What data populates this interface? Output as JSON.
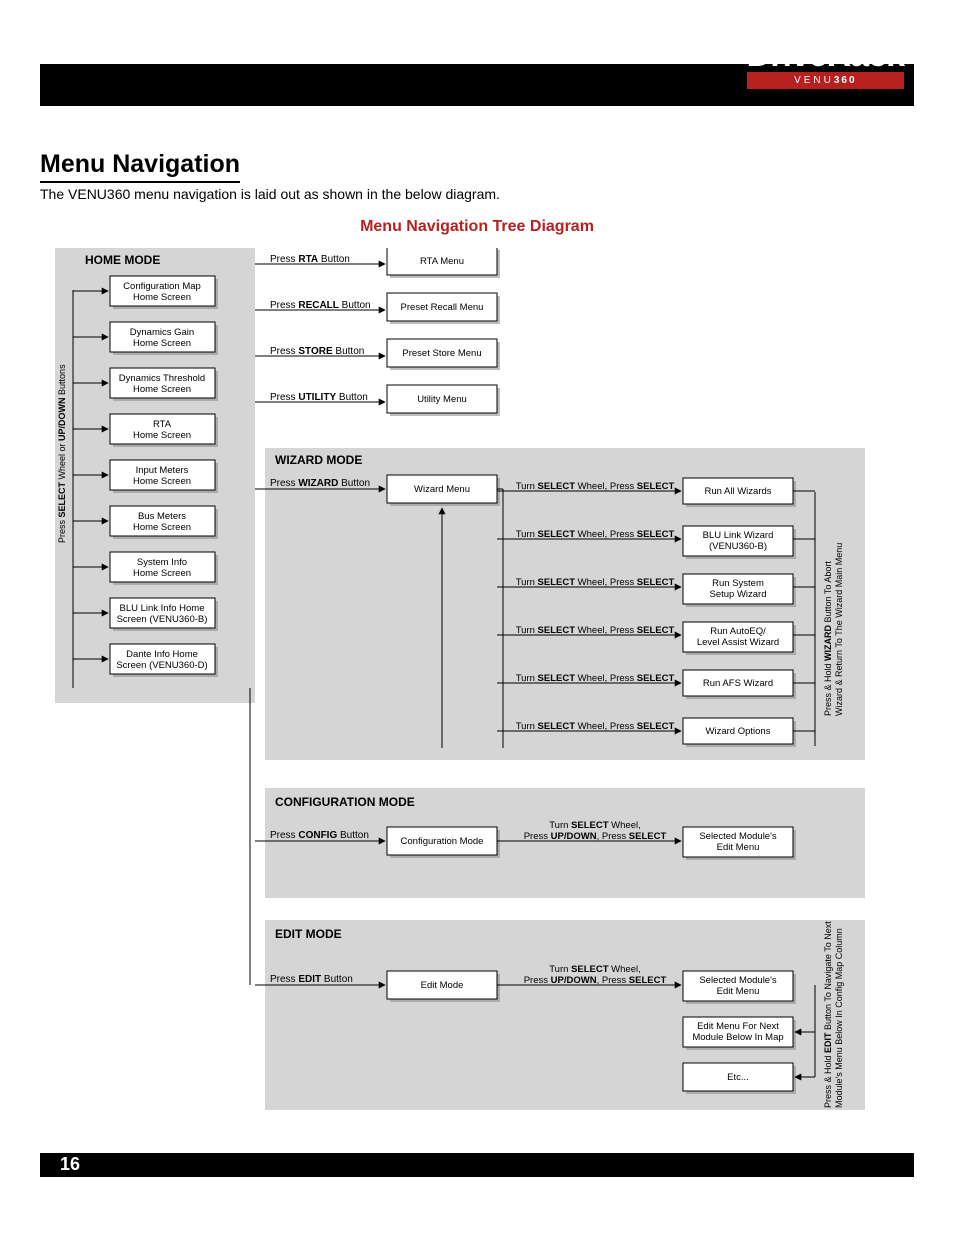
{
  "brand": {
    "name": "DriveRack",
    "sub_pre": "VENU",
    "sub_bold": "360",
    "reg": "®"
  },
  "page": {
    "num": "16"
  },
  "section": {
    "title": "Menu Navigation",
    "intro": "The VENU360 menu navigation is laid out as shown in the below diagram.",
    "tree_title": "Menu Navigation Tree Diagram"
  },
  "home": {
    "title": "HOME MODE",
    "side_label_a": "Press ",
    "side_label_b": "SELECT",
    "side_label_c": " Wheel or ",
    "side_label_d": "UP/DOWN",
    "side_label_e": " Buttons",
    "screens": [
      "Configuration Map\nHome Screen",
      "Dynamics Gain\nHome Screen",
      "Dynamics Threshold\nHome Screen",
      "RTA\nHome Screen",
      "Input Meters\nHome Screen",
      "Bus Meters\nHome Screen",
      "System Info\nHome Screen",
      "BLU Link Info Home\nScreen (VENU360-B)",
      "Dante Info Home\nScreen (VENU360-D)"
    ],
    "buttons": [
      "RTA",
      "RECALL",
      "STORE",
      "UTILITY"
    ],
    "btn_pre": "Press ",
    "btn_suf": " Button",
    "menus": [
      "RTA Menu",
      "Preset Recall Menu",
      "Preset Store Menu",
      "Utility Menu"
    ]
  },
  "wizard": {
    "title": "WIZARD MODE",
    "btn_pre": "Press ",
    "btn_name": "WIZARD",
    "btn_suf": " Button",
    "menu": "Wizard Menu",
    "act_a": "Turn ",
    "act_b": "SELECT",
    "act_c": " Wheel, Press ",
    "act_d": "SELECT",
    "items": [
      "Run All Wizards",
      "BLU Link Wizard\n(VENU360-B)",
      "Run System\nSetup Wizard",
      "Run AutoEQ/\nLevel Assist Wizard",
      "Run AFS Wizard",
      "Wizard Options"
    ],
    "side_a": "Press & Hold ",
    "side_b": "WIZARD",
    "side_c": " Button To Abort\nWizard & Return To The Wizard Main Menu"
  },
  "config": {
    "title": "CONFIGURATION MODE",
    "btn_pre": "Press ",
    "btn_name": "CONFIG",
    "btn_suf": " Button",
    "menu": "Configuration Mode",
    "act_a": "Turn ",
    "act_b": "SELECT",
    "act_c": " Wheel,\nPress ",
    "act_d": "UP/DOWN",
    "act_e": ", Press ",
    "act_f": "SELECT",
    "dest": "Selected Module's\nEdit Menu"
  },
  "edit": {
    "title": "EDIT MODE",
    "btn_pre": "Press ",
    "btn_name": "EDIT",
    "btn_suf": " Button",
    "menu": "Edit Mode",
    "dest": "Selected Module's\nEdit Menu",
    "next": "Edit Menu For Next\nModule Below In Map",
    "etc": "Etc...",
    "side_a": "Press & Hold ",
    "side_b": "EDIT",
    "side_c": " Button To Navigate To Next\nModule's Menu Below In Config Map Column"
  }
}
